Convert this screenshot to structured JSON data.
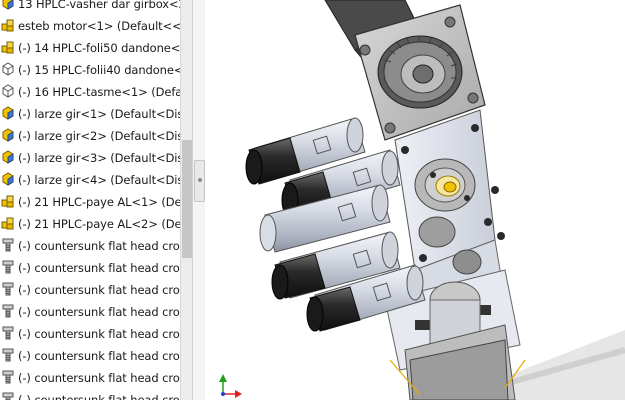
{
  "tree": {
    "items": [
      {
        "label": "13 HPLC-vasher dar girbox<2>",
        "icon": "part-icon"
      },
      {
        "label": "esteb motor<1> (Default<<De",
        "icon": "assembly-icon"
      },
      {
        "label": "(-) 14 HPLC-foli50 dandone<1:",
        "icon": "assembly-icon"
      },
      {
        "label": "(-) 15 HPLC-folii40 dandone<1",
        "icon": "part-outline-icon"
      },
      {
        "label": "(-) 16 HPLC-tasme<1> (Defau",
        "icon": "part-outline-icon"
      },
      {
        "label": "(-) larze gir<1> (Default<Displa",
        "icon": "part-icon"
      },
      {
        "label": "(-) larze gir<2> (Default<Displa",
        "icon": "part-icon"
      },
      {
        "label": "(-) larze gir<3> (Default<Displa",
        "icon": "part-icon"
      },
      {
        "label": "(-) larze gir<4> (Default<Displa",
        "icon": "part-icon"
      },
      {
        "label": "(-) 21 HPLC-paye AL<1> (Defa",
        "icon": "assembly-icon"
      },
      {
        "label": "(-) 21 HPLC-paye AL<2> (Defa",
        "icon": "assembly-icon"
      },
      {
        "label": "(-) countersunk flat head cross",
        "icon": "screw-icon"
      },
      {
        "label": "(-) countersunk flat head cross",
        "icon": "screw-icon"
      },
      {
        "label": "(-) countersunk flat head cross",
        "icon": "screw-icon"
      },
      {
        "label": "(-) countersunk flat head cross",
        "icon": "screw-icon"
      },
      {
        "label": "(-) countersunk flat head cross",
        "icon": "screw-icon"
      },
      {
        "label": "(-) countersunk flat head cross",
        "icon": "screw-icon"
      },
      {
        "label": "(-) countersunk flat head cross",
        "icon": "screw-icon"
      },
      {
        "label": "(-) countersunk flat head cross",
        "icon": "screw-icon"
      }
    ]
  },
  "viewport": {
    "model": "3d-assembly-model",
    "triad": "coordinate-triad-icon"
  },
  "colors": {
    "part_yellow": "#f2c200",
    "part_blue": "#3d78c8",
    "metal_gray": "#9a9a9a",
    "triad_red": "#e02020",
    "triad_green": "#20a020",
    "triad_blue": "#2040e0"
  }
}
